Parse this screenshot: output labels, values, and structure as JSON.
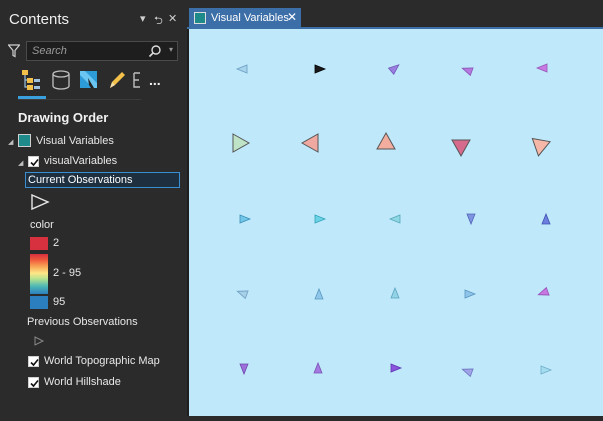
{
  "contents_pane": {
    "title": "Contents",
    "controls": {
      "menu": "▾",
      "pin": "⮌",
      "close": "✕"
    },
    "search": {
      "placeholder": "Search"
    },
    "toolbar": {
      "more": "...",
      "items": [
        "list-by-drawing-order-icon",
        "list-by-source-icon",
        "list-by-selection-icon",
        "list-by-editing-icon",
        "list-by-snapping-icon"
      ]
    },
    "section_title": "Drawing Order",
    "map_item": "Visual Variables",
    "layer_item": "visualVariables",
    "selected_item": "Current Observations",
    "color_label": "color",
    "ramp_labels": {
      "low": "2",
      "mid": "2 - 95",
      "high": "95"
    },
    "ramp_colors": [
      "#d7303e",
      "#f05a3c",
      "#f8a857",
      "#fde788",
      "#b7e38f",
      "#50b9b4",
      "#2b7fbf"
    ],
    "previous_item": "Previous Observations",
    "topo_item": "World Topographic Map",
    "hillshade_item": "World Hillshade"
  },
  "map_view": {
    "tab_label": "Visual Variables",
    "tab_close": "✕",
    "background_color": "#bfe8fb",
    "accent_color": "#3c6ea8"
  }
}
